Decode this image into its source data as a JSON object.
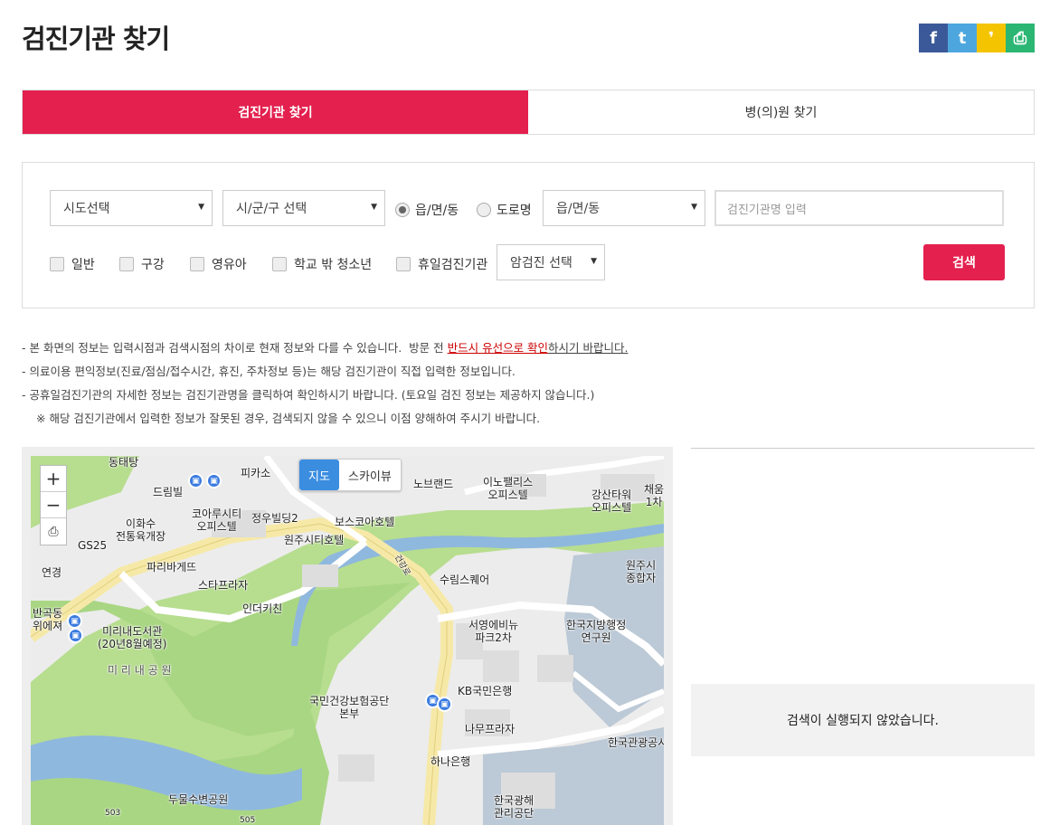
{
  "page": {
    "title": "검진기관 찾기"
  },
  "share": {
    "facebook": "f",
    "twitter": "t",
    "kakao": "❜",
    "print": "⎙"
  },
  "colors": {
    "accent": "#e3204e",
    "facebook": "#3b5998",
    "twitter": "#4da7de",
    "kakao": "#f5c400",
    "print": "#2bb673",
    "map_button": "#3b8de0"
  },
  "tabs": [
    {
      "label": "검진기관 찾기",
      "active": true
    },
    {
      "label": "병(의)원 찾기",
      "active": false
    }
  ],
  "search": {
    "sido": "시도선택",
    "sigungu": "시/군/구 선택",
    "radio_emd": "읍/면/동",
    "radio_road": "도로명",
    "emd_select": "읍/면/동",
    "name_placeholder": "검진기관명 입력",
    "checkboxes": [
      "일반",
      "구강",
      "영유아",
      "학교 밖 청소년",
      "휴일검진기관"
    ],
    "cancer_select": "암검진 선택",
    "search_button": "검색"
  },
  "notes": {
    "line1_a": "- 본 화면의 정보는 입력시점과 검색시점의 차이로 현재 정보와 다를 수 있습니다.  방문 전 ",
    "line1_b": "반드시 유선으로 확인",
    "line1_c": "하시기 바랍니다.",
    "line2": "- 의료이용 편익정보(진료/점심/접수시간, 휴진, 주차정보 등)는 해당 검진기관이 직접 입력한 정보입니다.",
    "line3": "- 공휴일검진기관의 자세한 정보는 검진기관명을 클릭하여 확인하시기 바랍니다. (토요일 검진 정보는 제공하지 않습니다.)",
    "line4": "※ 해당 검진기관에서 입력한 정보가 잘못된 경우, 검색되지 않을 수 있으니 이점 양해하여 주시기 바랍니다."
  },
  "map": {
    "zoom_in": "+",
    "zoom_out": "−",
    "print": "⎙",
    "type_map": "지도",
    "type_sky": "스카이뷰",
    "labels": [
      "동태탕",
      "드림빌",
      "피카소",
      "노브랜드",
      "이노팰리스\n오피스텔",
      "강산타워\n오피스텔",
      "채움\n1차",
      "이화수\n전통육개장",
      "코아루시티\n오피스텔",
      "정우빌딩2",
      "보스코아호텔",
      "원주시티호텔",
      "GS25",
      "연경",
      "파리바게뜨",
      "스타프라자",
      "원주시\n종합자",
      "수림스퀘어",
      "인더키친",
      "반곡동\n위에져",
      "미리내도서관\n(20년8월예정)",
      "서영에비뉴\n파크2차",
      "한국지방행정\n연구원",
      "미 리 내 공 원",
      "KB국민은행",
      "국민건강보험공단\n본부",
      "나무프라자",
      "한국관광공시",
      "하나은행",
      "두물수변공원",
      "한국광해\n관리공단",
      "503",
      "505",
      "건강로"
    ]
  },
  "result": {
    "message": "검색이 실행되지 않았습니다."
  }
}
